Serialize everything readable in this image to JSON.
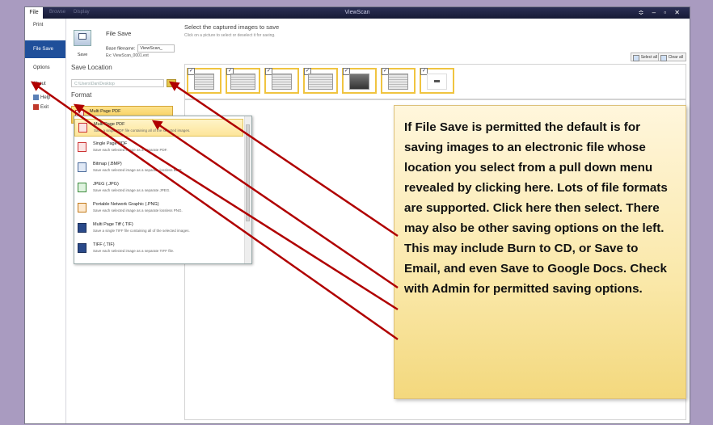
{
  "titlebar": {
    "app_title": "ViewScan",
    "tab_file": "File",
    "tab_2": "Browse",
    "tab_3": "Display",
    "controls": "≎ – ▫ ✕"
  },
  "left_nav": {
    "items": [
      {
        "label": "Print"
      },
      {
        "label": "File Save"
      },
      {
        "label": "Options"
      },
      {
        "label": "About"
      },
      {
        "label": "Help"
      },
      {
        "label": "Exit"
      }
    ]
  },
  "file_save": {
    "title": "File Save",
    "save_label": "Save",
    "base_filename_label": "Base filename:",
    "base_filename_value": "ViewScan_",
    "example": "Ex: ViewScan_0001.ext"
  },
  "save_location": {
    "heading": "Save Location",
    "path_placeholder": "C:\\Users\\Dan\\Desktop"
  },
  "format": {
    "heading": "Format",
    "selected_name": "Multi Page PDF",
    "selected_desc": "Save a single PDF file containing all o",
    "options": [
      {
        "name": "Multi Page PDF",
        "desc": "Save a single PDF file containing all of the selected images."
      },
      {
        "name": "Single Page PDF",
        "desc": "Save each selected image as a separate PDF."
      },
      {
        "name": "Bitmap (.BMP)",
        "desc": "Save each selected image as a separate lossless BMP."
      },
      {
        "name": "JPEG (.JPG)",
        "desc": "Save each selected image as a separate JPEG."
      },
      {
        "name": "Portable Network Graphic (.PNG)",
        "desc": "Save each selected image as a separate lossless PNG."
      },
      {
        "name": "Multi Page Tiff (.TIF)",
        "desc": "Save a single TIFF file containing all of the selected images."
      },
      {
        "name": "TIFF (.TIF)",
        "desc": "Save each selected image as a separate TIFF file."
      }
    ]
  },
  "main": {
    "title": "Select the captured images to save",
    "subtitle": "Click on a picture to select or deselect it for saving.",
    "select_all": "Select all",
    "clear_all": "Clear all",
    "thumbnail_count": 7
  },
  "callout": {
    "text": "If File Save is permitted the default is for saving images to an electronic file whose location you select from a pull down menu revealed by clicking here. Lots of file formats are supported. Click here then select. There may also be other saving options on the left. This may include Burn to CD, or Save to Email, and even Save to Google Docs. Check with Admin for permitted saving options."
  },
  "colors": {
    "background": "#a99bc0",
    "nav_selected": "#1f4f9a",
    "highlight": "#fde59a",
    "arrow": "#b00000",
    "callout": "#fae8a9"
  }
}
